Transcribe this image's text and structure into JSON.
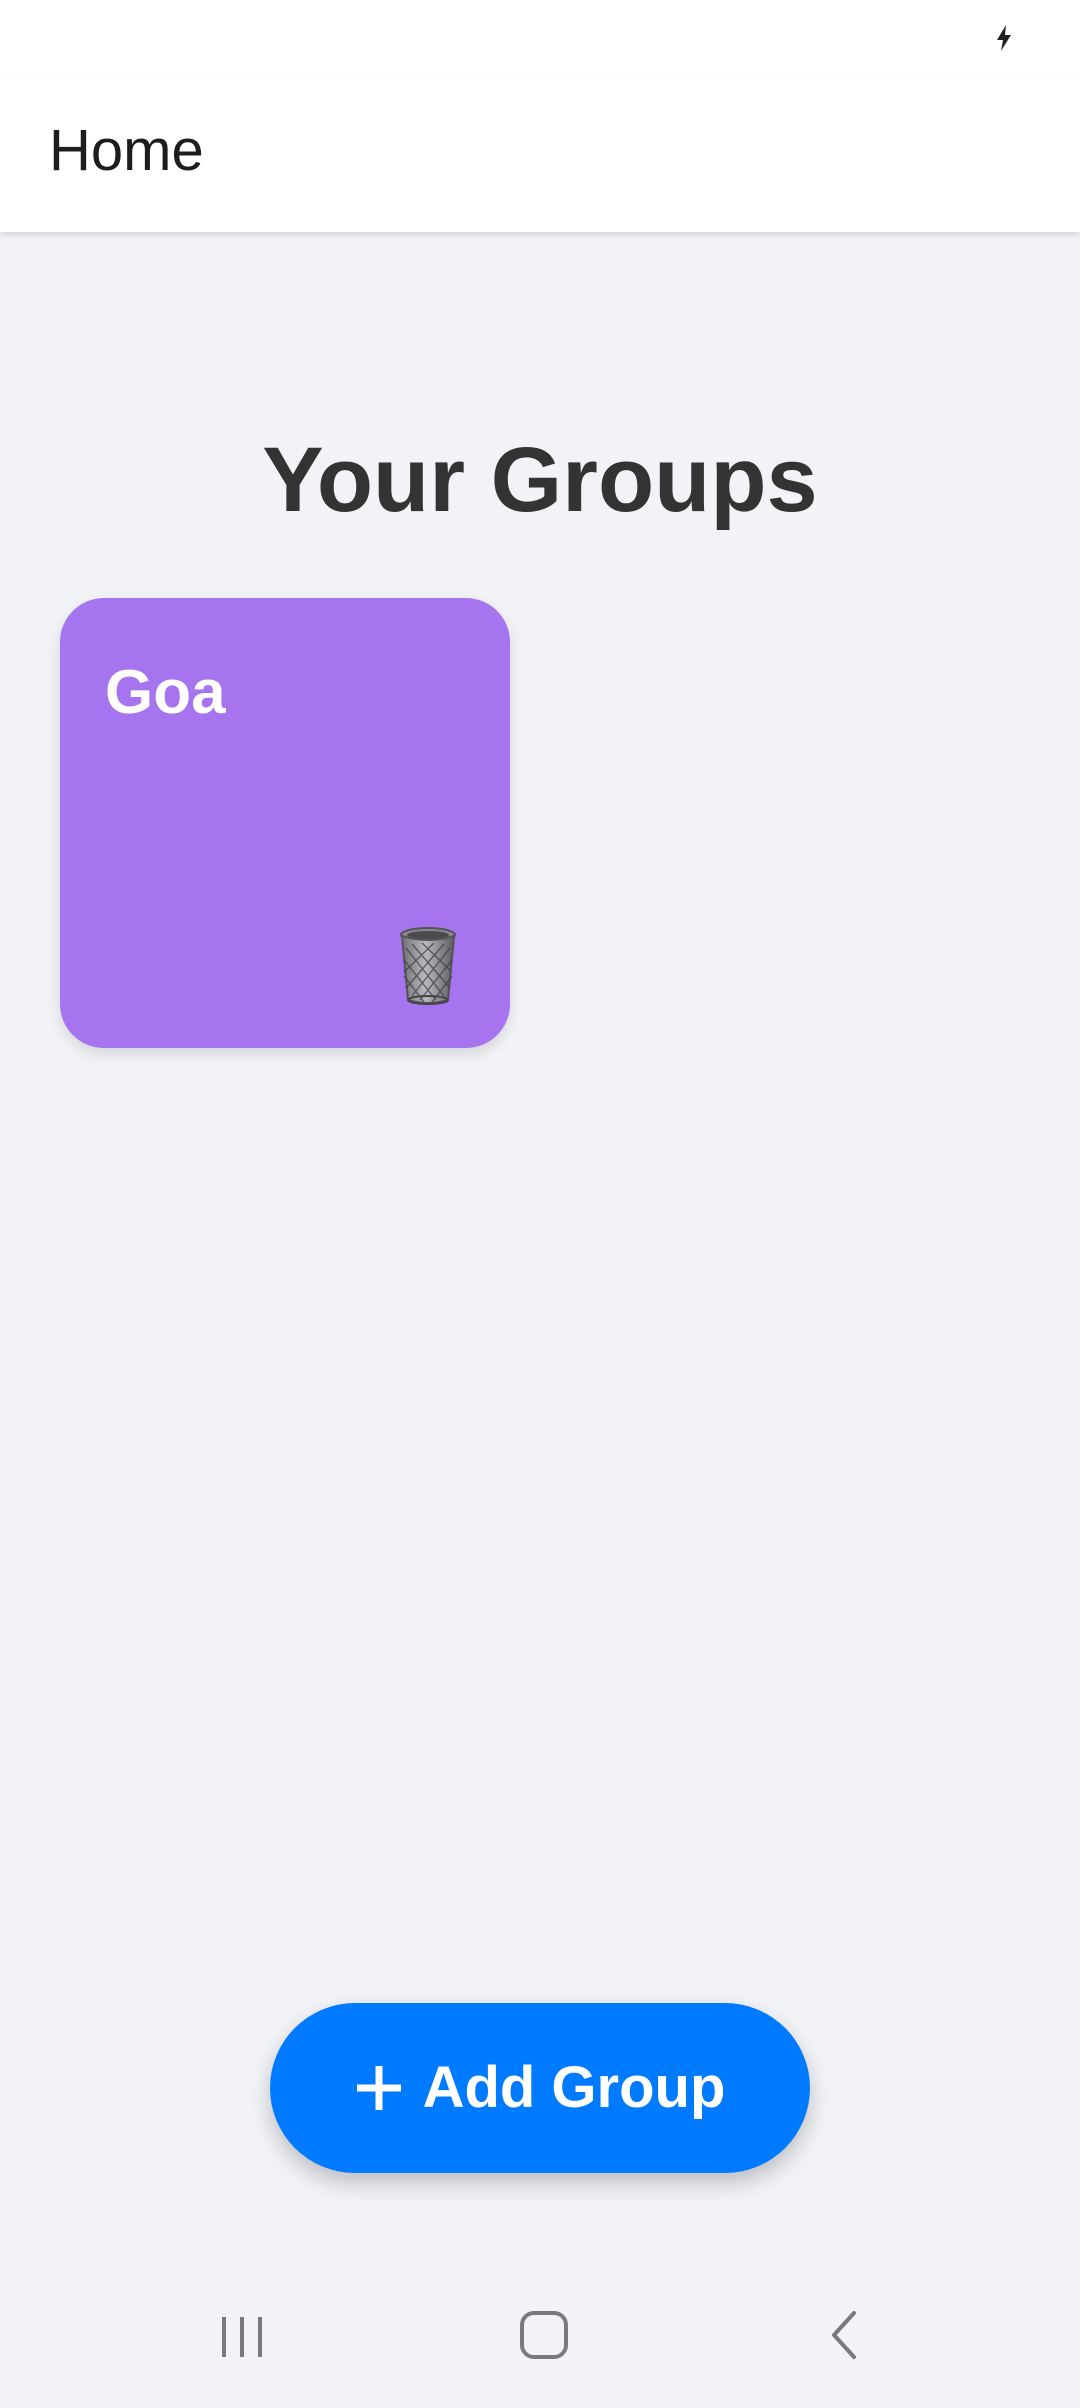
{
  "colors": {
    "accent": "#007aff",
    "card": "#a674ee",
    "background": "#f2f3f7"
  },
  "status_bar": {
    "icons": [
      "charging-bolt-icon"
    ]
  },
  "header": {
    "title": "Home"
  },
  "main": {
    "section_title": "Your Groups",
    "groups": [
      {
        "name": "Goa",
        "delete_icon": "trash-can-icon"
      }
    ],
    "add_button": {
      "icon": "plus-icon",
      "label": "Add Group"
    }
  },
  "nav_bar": {
    "buttons": [
      "recents-icon",
      "home-icon",
      "back-icon"
    ]
  }
}
